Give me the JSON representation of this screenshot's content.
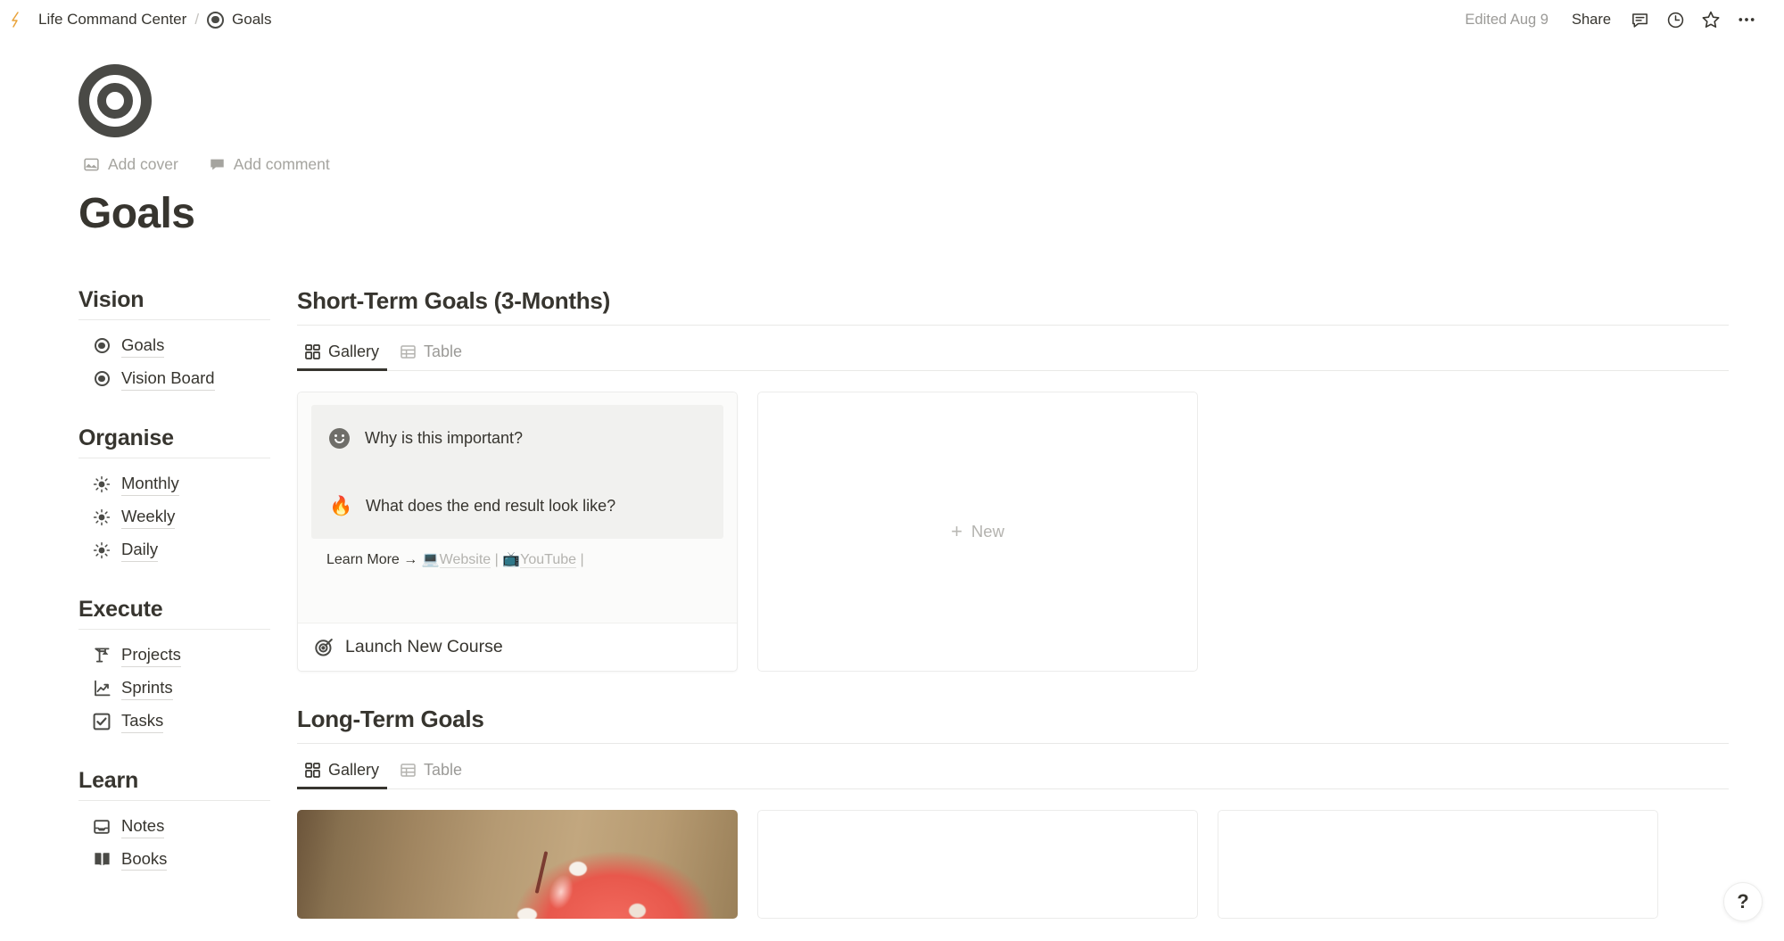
{
  "topbar": {
    "logo_icon": "lightning-logo",
    "breadcrumb_parent": "Life Command Center",
    "breadcrumb_separator": "/",
    "breadcrumb_current": "Goals",
    "breadcrumb_current_icon": "bullseye-icon",
    "edited": "Edited Aug 9",
    "share_label": "Share",
    "comment_icon": "comment-icon",
    "history_icon": "clock-history-icon",
    "favorite_icon": "star-icon",
    "more_icon": "more-horizontal-icon"
  },
  "page": {
    "icon": "bullseye-icon",
    "add_cover_label": "Add cover",
    "add_cover_icon": "image-icon",
    "add_comment_label": "Add comment",
    "add_comment_icon": "comment-icon",
    "title": "Goals"
  },
  "sidebar": {
    "groups": [
      {
        "heading": "Vision",
        "items": [
          {
            "label": "Goals",
            "icon": "bullseye-icon"
          },
          {
            "label": "Vision Board",
            "icon": "bullseye-icon"
          }
        ]
      },
      {
        "heading": "Organise",
        "items": [
          {
            "label": "Monthly",
            "icon": "sun-icon"
          },
          {
            "label": "Weekly",
            "icon": "sun-icon"
          },
          {
            "label": "Daily",
            "icon": "sun-icon"
          }
        ]
      },
      {
        "heading": "Execute",
        "items": [
          {
            "label": "Projects",
            "icon": "crane-icon"
          },
          {
            "label": "Sprints",
            "icon": "chart-increasing-icon"
          },
          {
            "label": "Tasks",
            "icon": "checkbox-checked-icon"
          }
        ]
      },
      {
        "heading": "Learn",
        "items": [
          {
            "label": "Notes",
            "icon": "tray-icon"
          },
          {
            "label": "Books",
            "icon": "open-book-icon"
          }
        ]
      }
    ]
  },
  "sections": [
    {
      "title": "Short-Term Goals (3-Months)",
      "tabs": [
        {
          "label": "Gallery",
          "icon": "gallery-grid-icon",
          "active": true
        },
        {
          "label": "Table",
          "icon": "table-icon",
          "active": false
        }
      ],
      "cards": {
        "preview_rows": [
          {
            "icon": "smiley-icon",
            "text": "Why is this important?"
          },
          {
            "icon": "fire-emoji",
            "text": "What does the end result look like?"
          }
        ],
        "learn_more_prefix": "Learn More",
        "learn_more_arrow": "→",
        "website_emoji": "laptop-emoji",
        "website_label": "Website",
        "youtube_emoji": "television-emoji",
        "youtube_label": "YouTube",
        "pipe": "|",
        "card_title": "Launch New Course",
        "card_title_icon": "dart-icon",
        "new_label": "New",
        "new_icon": "plus-icon"
      }
    },
    {
      "title": "Long-Term Goals",
      "tabs": [
        {
          "label": "Gallery",
          "icon": "gallery-grid-icon",
          "active": true
        },
        {
          "label": "Table",
          "icon": "table-icon",
          "active": false
        }
      ],
      "image_card_alt": "red piggy bank photo"
    }
  ],
  "help": {
    "label": "?"
  },
  "colors": {
    "text": "#37352f",
    "muted": "#9b9a97",
    "border": "#e9e9e7",
    "logo_orange": "#e9a33a",
    "preview_bg": "#f1f1ef"
  }
}
